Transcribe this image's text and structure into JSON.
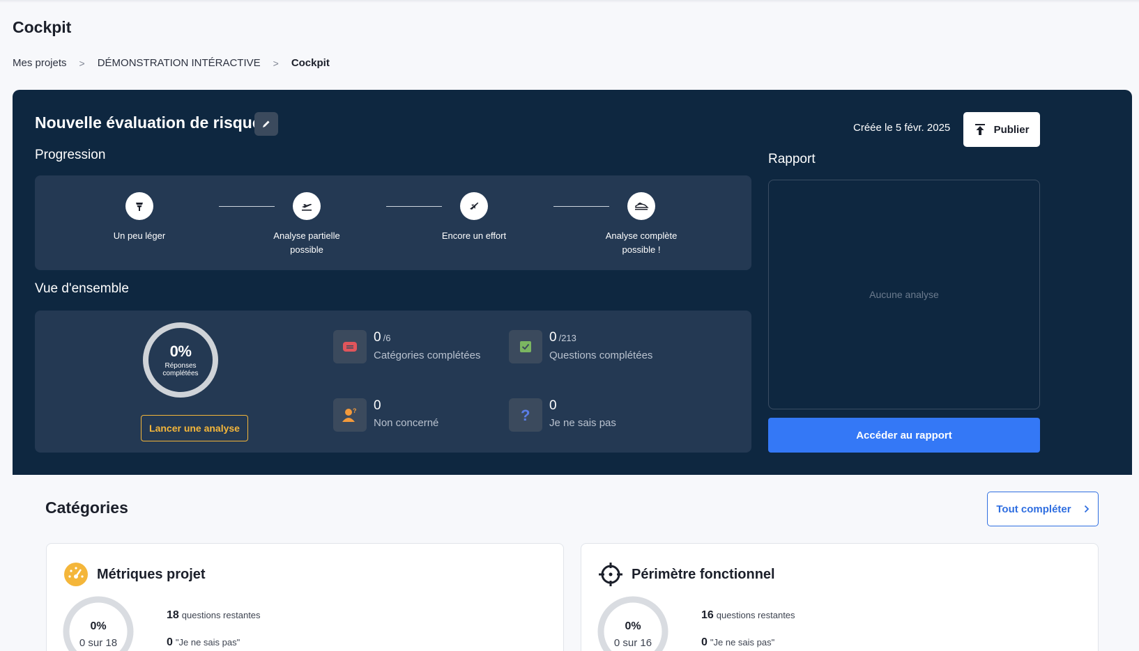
{
  "page": {
    "title": "Cockpit"
  },
  "breadcrumb": {
    "items": [
      "Mes projets",
      "DÉMONSTRATION INTÉRACTIVE",
      "Cockpit"
    ],
    "sep": ">"
  },
  "evaluation": {
    "title": "Nouvelle évaluation de risques",
    "created": "Créée le 5 févr. 2025",
    "publish_label": "Publier"
  },
  "progression": {
    "label": "Progression",
    "steps": [
      {
        "label": "Un peu léger",
        "icon": "windsock-icon"
      },
      {
        "label": "Analyse partielle possible",
        "icon": "plane-takeoff-icon"
      },
      {
        "label": "Encore un effort",
        "icon": "plane-icon"
      },
      {
        "label": "Analyse complète possible !",
        "icon": "plane-landing-icon"
      }
    ]
  },
  "overview": {
    "label": "Vue d'ensemble",
    "percent": "0%",
    "percent_sub": "Réponses complétées",
    "analyse_label": "Lancer une analyse",
    "stats": {
      "categories": {
        "value": "0",
        "total": "/6",
        "label": "Catégories complétées",
        "color": "#e0555b"
      },
      "questions": {
        "value": "0",
        "total": "/213",
        "label": "Questions complétées",
        "color": "#7bb661"
      },
      "not_concerned": {
        "value": "0",
        "label": "Non concerné",
        "color": "#f39a3b"
      },
      "unknown": {
        "value": "0",
        "label": "Je ne sais pas",
        "color": "#5b7de8"
      }
    }
  },
  "report": {
    "label": "Rapport",
    "empty": "Aucune analyse",
    "access_label": "Accéder au rapport"
  },
  "categories": {
    "title": "Catégories",
    "complete_all": "Tout compléter",
    "items": [
      {
        "name": "Métriques projet",
        "icon": "gauge-icon",
        "percent": "0%",
        "progress": "0 sur 18",
        "remaining": "18",
        "remaining_label": "questions restantes",
        "unknown": "0",
        "unknown_label": "\"Je ne sais pas\""
      },
      {
        "name": "Périmètre fonctionnel",
        "icon": "crosshair-icon",
        "percent": "0%",
        "progress": "0 sur 16",
        "remaining": "16",
        "remaining_label": "questions restantes",
        "unknown": "0",
        "unknown_label": "\"Je ne sais pas\""
      }
    ]
  },
  "colors": {
    "hero_bg": "#0e2740",
    "panel_bg": "#243953",
    "accent_blue": "#3478f6",
    "accent_orange": "#f4b63a"
  }
}
